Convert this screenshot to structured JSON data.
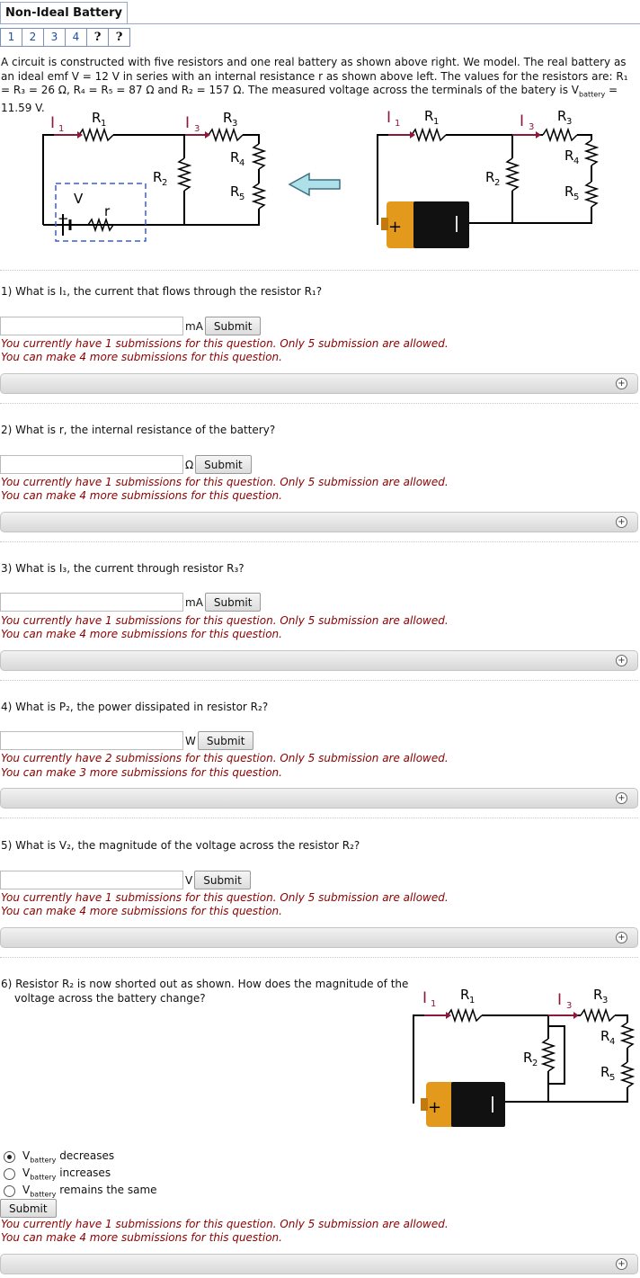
{
  "header": {
    "title": "Non-Ideal Battery",
    "tabs": [
      "1",
      "2",
      "3",
      "4",
      "?",
      "?"
    ]
  },
  "intro": "A circuit is constructed with five resistors and one real battery as shown above right. We model. The real battery as an ideal emf V = 12 V in series with an internal resistance r as shown above left. The values for the resistors are: R₁ = R₃ = 26 Ω, R₄ = R₅ = 87 Ω and R₂ = 157 Ω. The measured voltage across the terminals of the batery is V",
  "intro_sub": "battery",
  "intro_end": " = 11.59 V.",
  "diagram_labels": {
    "I1": "I",
    "I3": "I",
    "sub1": "1",
    "sub3": "3",
    "R": "R",
    "r": "r",
    "V": "V",
    "plus": "+",
    "minus": "−"
  },
  "questions": [
    {
      "text": "1) What is I₁, the current that flows through the resistor R₁?",
      "unit": "mA",
      "submit": "Submit",
      "msg1": "You currently have 1 submissions for this question. Only 5 submission are allowed.",
      "msg2": "You can make 4 more submissions for this question."
    },
    {
      "text": "2) What is r, the internal resistance of the battery?",
      "unit": "Ω",
      "submit": "Submit",
      "msg1": "You currently have 1 submissions for this question. Only 5 submission are allowed.",
      "msg2": "You can make 4 more submissions for this question."
    },
    {
      "text": "3) What is I₃, the current through resistor R₃?",
      "unit": "mA",
      "submit": "Submit",
      "msg1": "You currently have 1 submissions for this question. Only 5 submission are allowed.",
      "msg2": "You can make 4 more submissions for this question."
    },
    {
      "text": "4) What is P₂, the power dissipated in resistor R₂?",
      "unit": "W",
      "submit": "Submit",
      "msg1": "You currently have 2 submissions for this question. Only 5 submission are allowed.",
      "msg2": "You can make 3 more submissions for this question."
    },
    {
      "text": "5) What is V₂, the magnitude of the voltage across the resistor R₂?",
      "unit": "V",
      "submit": "Submit",
      "msg1": "You currently have 1 submissions for this question. Only 5 submission are allowed.",
      "msg2": "You can make 4 more submissions for this question."
    }
  ],
  "q6": {
    "line1": "6) Resistor R₂ is now shorted out as shown. How does the magnitude of the",
    "line2": "voltage across the battery change?",
    "options": [
      {
        "pre": "V",
        "sub": "battery",
        "post": " decreases",
        "selected": true
      },
      {
        "pre": "V",
        "sub": "battery",
        "post": " increases",
        "selected": false
      },
      {
        "pre": "V",
        "sub": "battery",
        "post": " remains the same",
        "selected": false
      }
    ],
    "submit": "Submit",
    "msg1": "You currently have 1 submissions for this question. Only 5 submission are allowed.",
    "msg2": "You can make 4 more submissions for this question."
  },
  "expand_icon": "plus-circle-icon",
  "colors": {
    "current_arrow": "#8b1a3a",
    "dashed_box": "#3b5bdb",
    "arrow_fill": "#aee0ea",
    "error_text": "#8b0000"
  }
}
